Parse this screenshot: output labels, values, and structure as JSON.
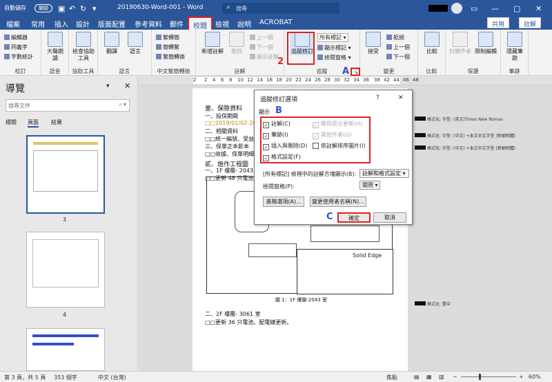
{
  "titlebar": {
    "autosave_label": "自動儲存",
    "autosave_state": "關閉",
    "doc_title": "20190630-Word-001 - Word",
    "search_placeholder": "搜尋"
  },
  "tabs": [
    "檔案",
    "常用",
    "插入",
    "設計",
    "版面配置",
    "參考資料",
    "郵件",
    "校閱",
    "檢視",
    "說明",
    "ACROBAT"
  ],
  "active_tab": "校閱",
  "share_label": "共用",
  "comments_label": "註解",
  "ribbon": {
    "proofing": {
      "label": "校訂",
      "items": [
        "編輯器",
        "同義字",
        "字數統計"
      ]
    },
    "speech": {
      "label": "語音",
      "item": "大聲朗讀"
    },
    "accessibility": {
      "label": "協助工具",
      "item": "檢查協助工具"
    },
    "language": {
      "label": "語言",
      "items": [
        "翻譯",
        "語言"
      ]
    },
    "chinese": {
      "label": "中文繁簡轉換",
      "items": [
        "繁轉簡",
        "簡轉繁",
        "繁簡轉換"
      ]
    },
    "comments": {
      "label": "註解",
      "items": [
        "新增註解",
        "刪除",
        "上一個",
        "下一個",
        "顯示註解"
      ]
    },
    "tracking": {
      "label": "追蹤",
      "items": [
        "追蹤修訂",
        "所有標記",
        "顯示標記",
        "檢閱窗格"
      ]
    },
    "changes": {
      "label": "變更",
      "items": [
        "接受",
        "拒絕",
        "上一個",
        "下一個"
      ]
    },
    "compare": {
      "label": "比較",
      "item": "比較"
    },
    "protect": {
      "label": "保護",
      "items": [
        "封鎖作者",
        "限制編輯"
      ]
    },
    "ink": {
      "label": "筆跡",
      "item": "隱藏筆跡"
    }
  },
  "annotations": {
    "one": "1",
    "two": "2",
    "a": "A",
    "b": "B",
    "c": "C"
  },
  "ruler_ticks": [
    "2",
    "2",
    "4",
    "6",
    "8",
    "10",
    "12",
    "14",
    "16",
    "18",
    "20",
    "22",
    "24",
    "26",
    "28",
    "30",
    "32",
    "34",
    "36",
    "38",
    "42",
    "44",
    "46",
    "48"
  ],
  "nav": {
    "title": "導覽",
    "search_placeholder": "搜尋文件",
    "tabs": [
      "標題",
      "頁面",
      "結果"
    ],
    "active_tab": "頁面",
    "pages": [
      "3",
      "4"
    ]
  },
  "document": {
    "lines": [
      "壹、保險資料",
      "一、投保期間",
      "□□2019/01/02-2019/06/30",
      "二、相關資料",
      "□□統一編號、受益人、",
      "三、保單正本影本",
      "□□收據、保單明細。",
      "貳、施作工程圖",
      "一、1F 樓層- 2043 室",
      "□□更新 48 只電池、配電",
      "圖 1：1F 樓層-2043 室",
      "二、2F 樓層- 3061 室",
      "□□更新 36 只電池、配電線更新。"
    ],
    "title_block": "Solid Edge"
  },
  "comments": [
    "格式化: 字型: (英文)Times New Roman",
    "格式化: 字型: (中文) +本文中文字型 (新細明體)",
    "格式化: 字型: (中文) +本文中文字型 (新細明體)",
    "格式化: 置中"
  ],
  "dialog": {
    "title": "追蹤修訂選項",
    "help": "?",
    "close": "✕",
    "section": "顯示",
    "left_options": [
      {
        "label": "註解(C)",
        "checked": true
      },
      {
        "label": "筆跡(I)",
        "checked": true
      },
      {
        "label": "插入與刪除(D)",
        "checked": true
      },
      {
        "label": "格式設定(F)",
        "checked": true
      }
    ],
    "right_options": [
      {
        "label": "醒目提示更新(H)",
        "checked": true,
        "disabled": true
      },
      {
        "label": "其他作者(O)",
        "checked": true,
        "disabled": true
      },
      {
        "label": "依註解排序圖片(I)",
        "checked": false,
        "disabled": false
      }
    ],
    "balloons_label": "[所有標記] 檢視中的註解方塊顯示(B):",
    "balloons_value": "註解和格式設定",
    "pane_label": "檢閱窗格(P):",
    "pane_value": "關閉",
    "advanced": "進階選項(A)...",
    "change_user": "變更使用者名稱(N)...",
    "ok": "確定",
    "cancel": "取消"
  },
  "status": {
    "page": "第 3 頁，共 5 頁",
    "words": "353 個字",
    "lang": "中文 (台灣)",
    "focus": "焦點",
    "zoom": "60%"
  },
  "colors": {
    "brand": "#2b579a",
    "annotation_red": "#e02020",
    "annotation_blue": "#3050c8"
  }
}
